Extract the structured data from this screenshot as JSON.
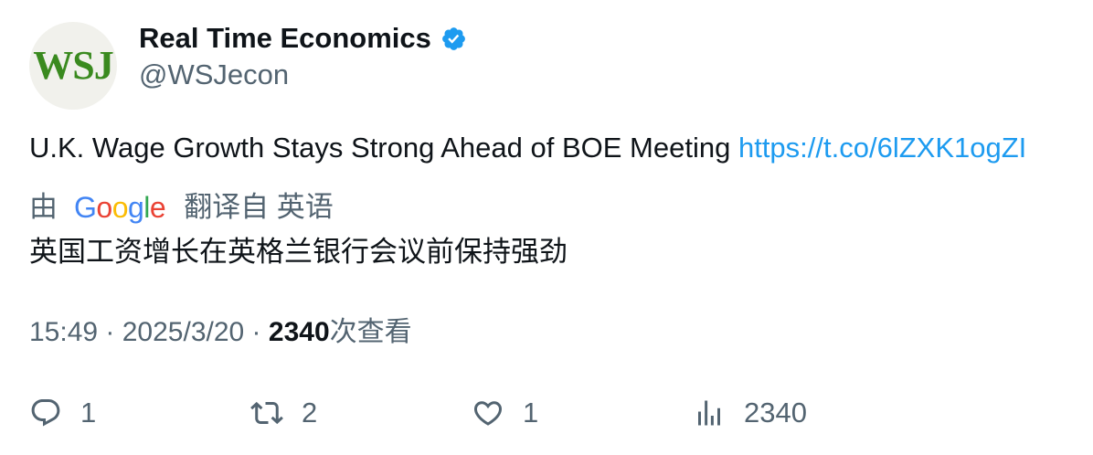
{
  "author": {
    "avatar_text": "WSJ",
    "display_name": "Real Time Economics",
    "handle": "@WSJecon",
    "verified": true
  },
  "tweet": {
    "text": "U.K. Wage Growth Stays Strong Ahead of BOE Meeting ",
    "link": "https://t.co/6lZXK1ogZI"
  },
  "translation": {
    "prefix": "由",
    "provider": "Google",
    "suffix": "翻译自 英语",
    "text": "英国工资增长在英格兰银行会议前保持强劲"
  },
  "meta": {
    "time": "15:49",
    "separator1": " · ",
    "date": "2025/3/20",
    "separator2": " · ",
    "views": "2340",
    "views_label": "次查看"
  },
  "actions": {
    "replies": "1",
    "retweets": "2",
    "likes": "1",
    "views": "2340"
  },
  "colors": {
    "accent": "#1d9bf0",
    "secondary_text": "#536471",
    "primary_text": "#0f1419"
  }
}
